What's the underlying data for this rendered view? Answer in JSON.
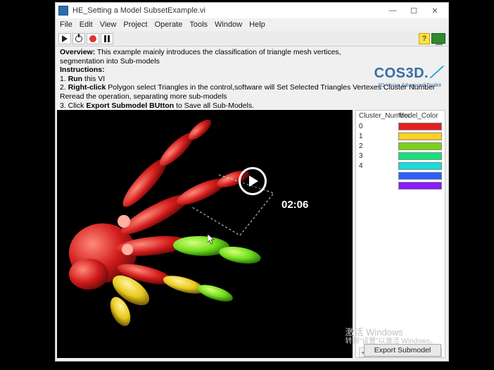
{
  "window": {
    "title": "HE_Setting a Model SubsetExample.vi",
    "minimize": "—",
    "maximize": "☐",
    "close": "✕"
  },
  "menu": {
    "file": "File",
    "edit": "Edit",
    "view": "View",
    "project": "Project",
    "operate": "Operate",
    "tools": "Tools",
    "window": "Window",
    "help": "Help"
  },
  "toolbar": {
    "help_glyph": "?"
  },
  "overview": {
    "label": "Overview:",
    "text1": " This example mainly introduces the classification of triangle mesh vertices,",
    "text2": "segmentation into Sub-models",
    "instr_label": "Instructions:",
    "i1a": "1. ",
    "i1b": "Run",
    "i1c": " this VI",
    "i2a": "2. ",
    "i2b": "Right-click",
    "i2c": " Polygon select Triangles in the control,software will Set Selected Triangles Vertexes Cluster Number",
    "i2d": "Reread the operation, separating more sub-models",
    "i3a": "3. Click ",
    "i3b": "Export Submodel BUtton",
    "i3c": " to Save all Sub-Models."
  },
  "brand": {
    "title": "COS3D.",
    "sub": "3D Vision Advanced Toolkit"
  },
  "panel": {
    "col1": "Cluster_Number",
    "col2": "Model_Color",
    "rows": [
      {
        "n": "0",
        "c": "#e62020"
      },
      {
        "n": "1",
        "c": "#ffd21f"
      },
      {
        "n": "2",
        "c": "#7bd11b"
      },
      {
        "n": "3",
        "c": "#16e07a"
      },
      {
        "n": "4",
        "c": "#17dddd"
      },
      {
        "n": "",
        "c": "#2a60ff"
      },
      {
        "n": "",
        "c": "#8a1bff"
      }
    ]
  },
  "activate": {
    "l1": "激活 Windows",
    "l2": "转到\"设置\"以激活 Windows。"
  },
  "export": {
    "label": "Export Submodel"
  },
  "video": {
    "time": "02:06"
  }
}
